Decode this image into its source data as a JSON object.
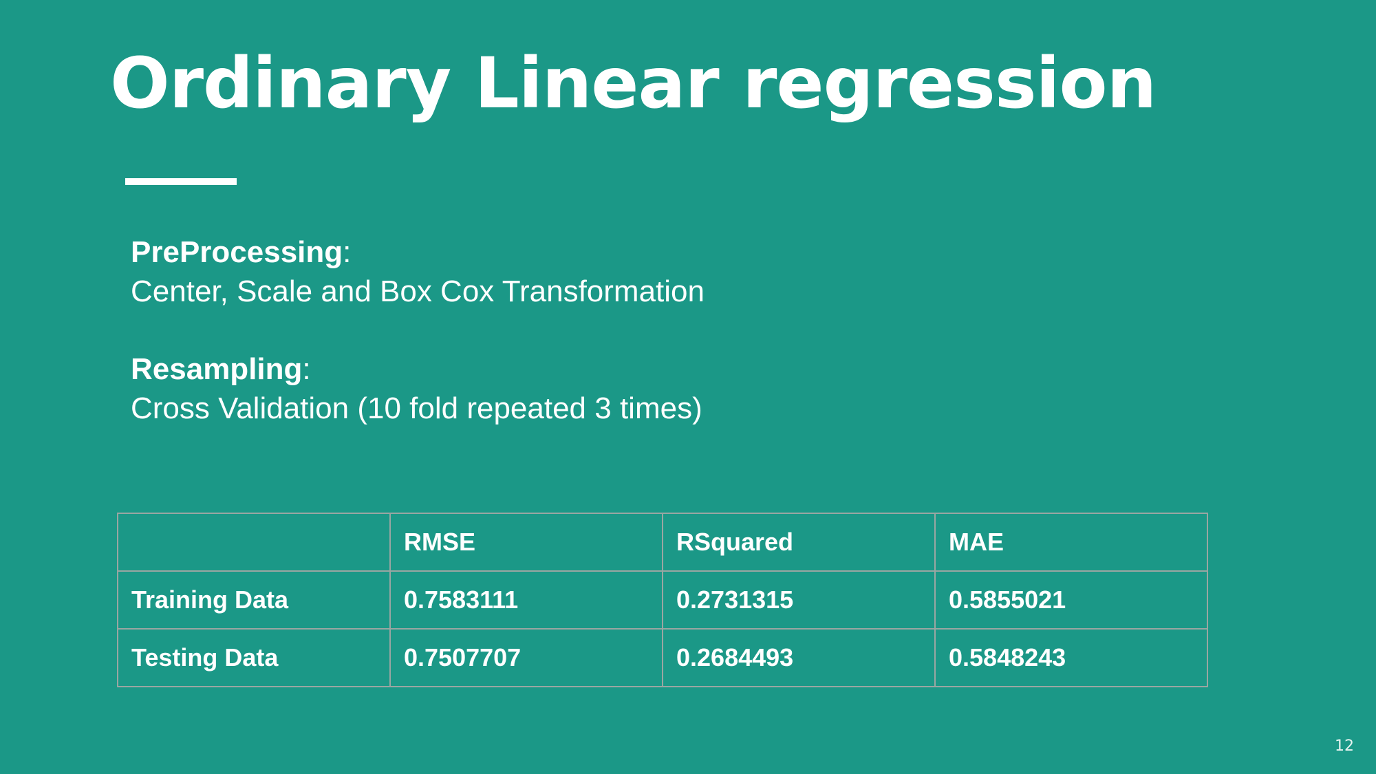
{
  "slide": {
    "title": "Ordinary Linear regression",
    "preprocessing_label": "PreProcessing",
    "preprocessing_text": "Center, Scale and Box Cox Transformation",
    "resampling_label": "Resampling",
    "resampling_text": "Cross Validation (10 fold repeated 3 times)",
    "separator": ":",
    "page_number": "12"
  },
  "table": {
    "headers": [
      "",
      "RMSE",
      "RSquared",
      "MAE"
    ],
    "rows": [
      {
        "label": "Training Data",
        "values": [
          "0.7583111",
          "0.2731315",
          "0.5855021"
        ]
      },
      {
        "label": "Testing Data",
        "values": [
          "0.7507707",
          "0.2684493",
          "0.5848243"
        ]
      }
    ]
  },
  "colors": {
    "background": "#1b9887",
    "text": "#ffffff",
    "table_border": "#9aa6a2"
  }
}
